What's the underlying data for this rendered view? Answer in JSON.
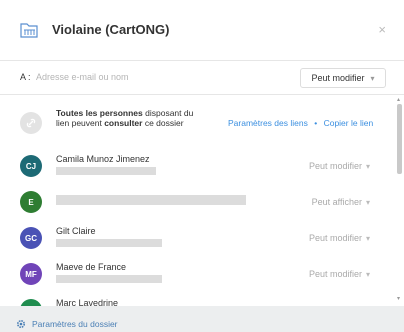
{
  "header": {
    "title": "Violaine (CartONG)",
    "close_glyph": "×",
    "folder_icon": "folder-shared-icon"
  },
  "share": {
    "label": "A :",
    "placeholder": "Adresse e-mail ou nom",
    "permission": "Peut modifier"
  },
  "link_row": {
    "bold_prefix": "Toutes les personnes",
    "text_a": " disposant du lien peuvent ",
    "bold_mid": "consulter",
    "text_b": " ce dossier",
    "settings_link": "Paramètres des liens",
    "separator": "•",
    "copy_link": "Copier le lien"
  },
  "members": [
    {
      "initials": "CJ",
      "name": "Camila Munoz Jimenez",
      "permission": "Peut modifier",
      "color": "#1d6a75"
    },
    {
      "initials": "E",
      "name": "",
      "permission": "Peut afficher",
      "color": "#2e7d32"
    },
    {
      "initials": "GC",
      "name": "Gilt Claire",
      "permission": "Peut modifier",
      "color": "#4a52b5"
    },
    {
      "initials": "MF",
      "name": "Maeve de France",
      "permission": "Peut modifier",
      "color": "#7044b8"
    },
    {
      "initials": "",
      "name": "Marc Lavedrine",
      "permission": "",
      "color": "#1f8c4e"
    }
  ],
  "footer": {
    "label": "Paramètres du dossier"
  },
  "colors": {
    "link": "#3b8fe0",
    "footer_link": "#4a7fb5",
    "background": "#eceeef"
  }
}
